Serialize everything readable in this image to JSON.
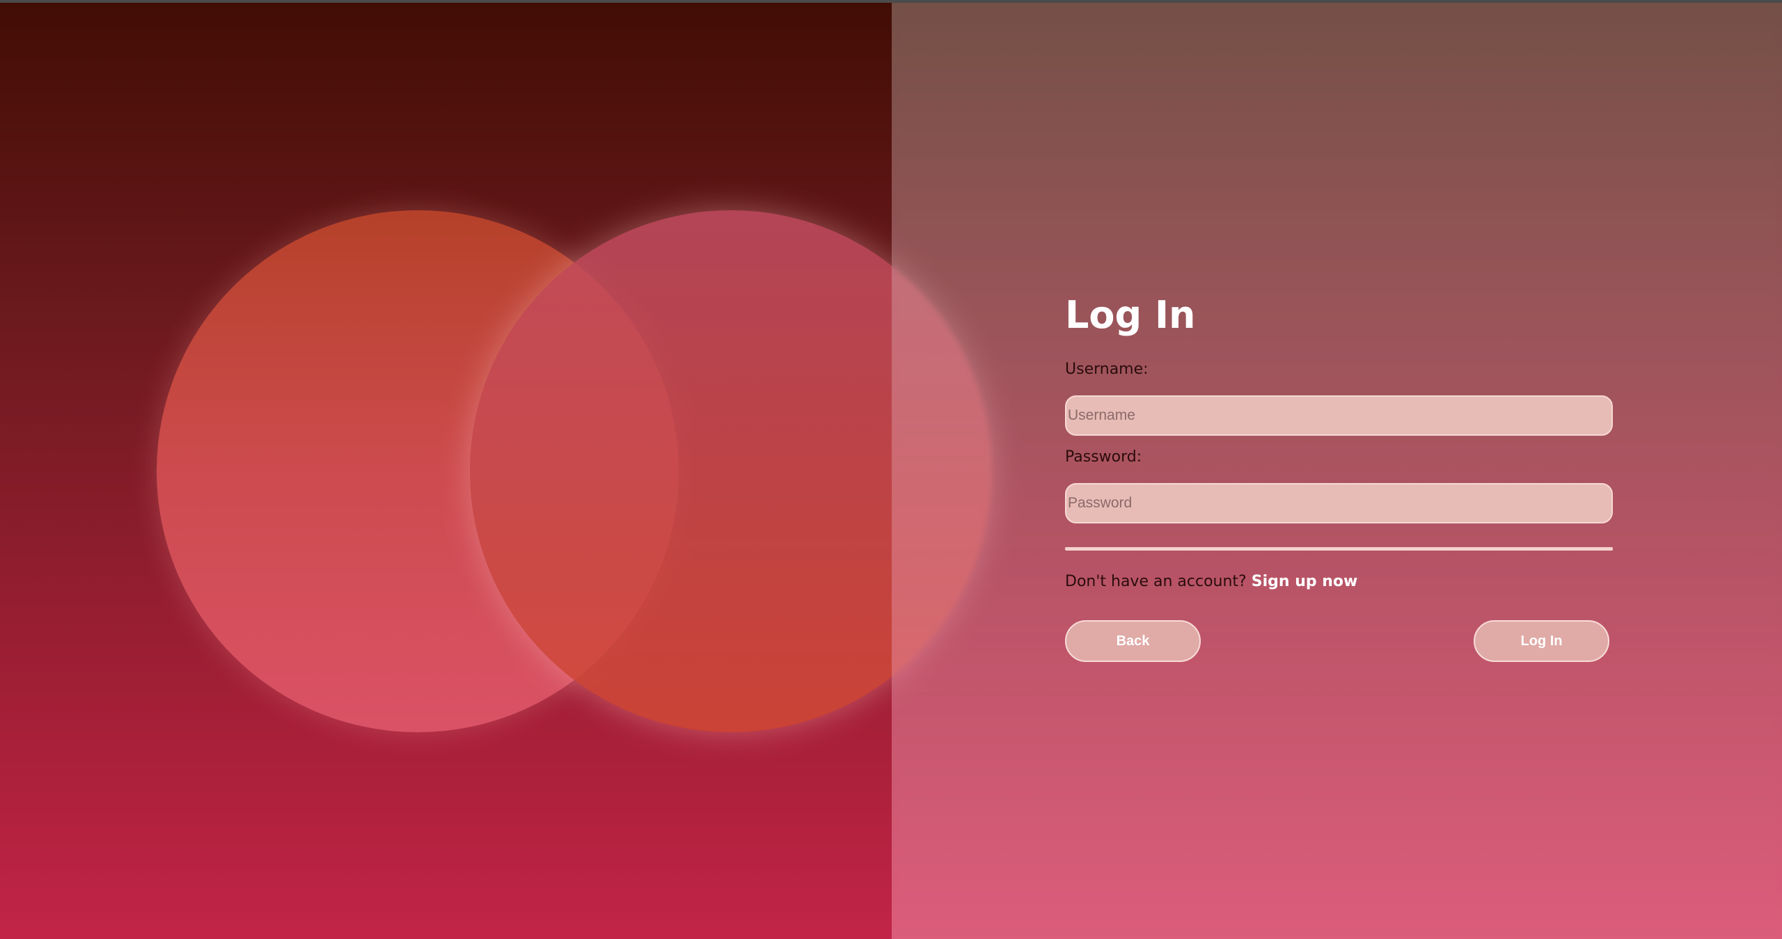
{
  "login": {
    "title": "Log In",
    "username_label": "Username:",
    "username_placeholder": "Username",
    "password_label": "Password:",
    "password_placeholder": "Password",
    "signup_prompt": "Don't have an account?",
    "signup_link": "Sign up now",
    "back_button": "Back",
    "login_button": "Log In"
  },
  "colors": {
    "background_top": "#410d04",
    "background_bottom": "#c22448",
    "circle_left": "#d04d50",
    "circle_right": "#c84a4c",
    "button_fill": "#e0aaa7",
    "input_fill": "#e8bcb6"
  }
}
